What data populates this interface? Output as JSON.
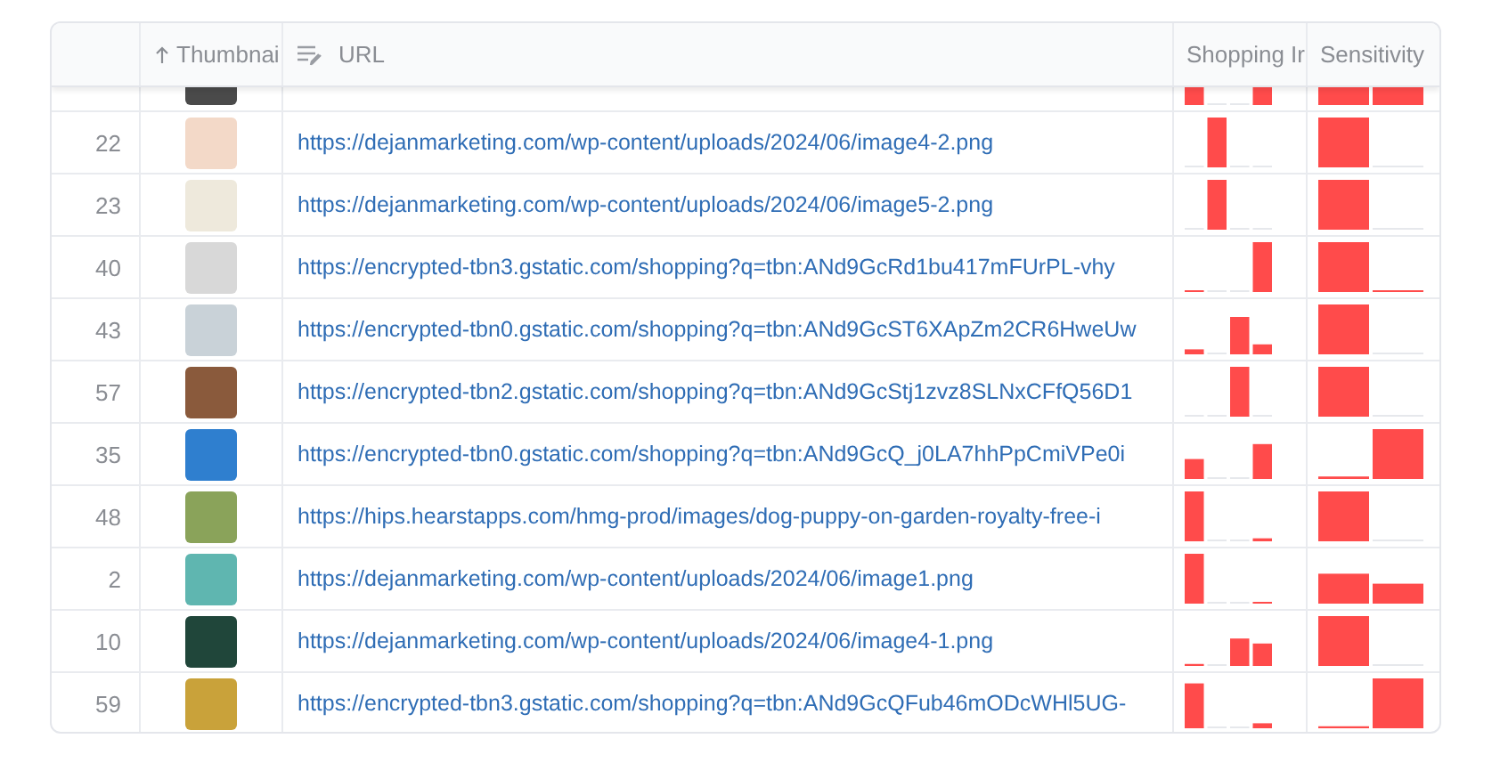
{
  "table": {
    "columns": [
      {
        "label": "Thumbnai",
        "sorted_ascending": true,
        "kind": "image"
      },
      {
        "label": "URL",
        "editable": true,
        "kind": "link"
      },
      {
        "label": "Shopping Ir",
        "kind": "bars4"
      },
      {
        "label": "Sensitivity",
        "kind": "bars2"
      }
    ],
    "rows": [
      {
        "clipped": true
      },
      {
        "clipped": false,
        "index": "22",
        "url": "https://dejanmarketing.com/wp-content/uploads/2024/06/image4-2.png"
      },
      {
        "clipped": false,
        "index": "23",
        "url": "https://dejanmarketing.com/wp-content/uploads/2024/06/image5-2.png"
      },
      {
        "clipped": false,
        "index": "40",
        "url": "https://encrypted-tbn3.gstatic.com/shopping?q=tbn:ANd9GcRd1bu417mFUrPL-vhy"
      },
      {
        "clipped": false,
        "index": "43",
        "url": "https://encrypted-tbn0.gstatic.com/shopping?q=tbn:ANd9GcST6XApZm2CR6HweUw"
      },
      {
        "clipped": false,
        "index": "57",
        "url": "https://encrypted-tbn2.gstatic.com/shopping?q=tbn:ANd9GcStj1zvz8SLNxCFfQ56D1"
      },
      {
        "clipped": false,
        "index": "35",
        "url": "https://encrypted-tbn0.gstatic.com/shopping?q=tbn:ANd9GcQ_j0LA7hhPpCmiVPe0i"
      },
      {
        "clipped": false,
        "index": "48",
        "url": "https://hips.hearstapps.com/hmg-prod/images/dog-puppy-on-garden-royalty-free-i"
      },
      {
        "clipped": false,
        "index": "2",
        "url": "https://dejanmarketing.com/wp-content/uploads/2024/06/image1.png"
      },
      {
        "clipped": false,
        "index": "10",
        "url": "https://dejanmarketing.com/wp-content/uploads/2024/06/image4-1.png"
      },
      {
        "clipped": false,
        "index": "59",
        "url": "https://encrypted-tbn3.gstatic.com/shopping?q=tbn:ANd9GcQFub46mODcWHl5UG-"
      }
    ]
  }
}
